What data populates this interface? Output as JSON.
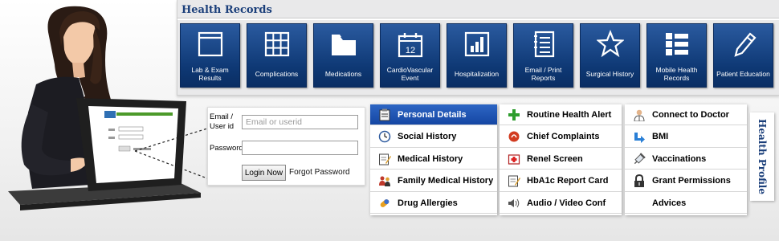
{
  "records": {
    "title": "Health Records",
    "tiles": [
      {
        "label": "Lab & Exam Results",
        "icon": "window-icon"
      },
      {
        "label": "Complications",
        "icon": "grid-icon"
      },
      {
        "label": "Medications",
        "icon": "folder-icon"
      },
      {
        "label": "CardioVascular Event",
        "icon": "calendar-icon",
        "icon_text": "12"
      },
      {
        "label": "Hospitalization",
        "icon": "bar-chart-icon"
      },
      {
        "label": "Email / Print Reports",
        "icon": "notebook-icon"
      },
      {
        "label": "Surgical History",
        "icon": "star-icon"
      },
      {
        "label": "Mobile Health Records",
        "icon": "list-icon"
      },
      {
        "label": "Patient Education",
        "icon": "pencil-icon"
      }
    ]
  },
  "login": {
    "email_label": "Email / User id",
    "email_placeholder": "Email or userid",
    "password_label": "Password",
    "login_button": "Login Now",
    "forgot_link": "Forgot Password"
  },
  "profile": {
    "tab_label": "Health Profile",
    "columns": [
      [
        {
          "label": "Personal Details",
          "icon": "clipboard-icon",
          "active": true
        },
        {
          "label": "Social History",
          "icon": "clock-icon"
        },
        {
          "label": "Medical History",
          "icon": "edit-note-icon"
        },
        {
          "label": "Family Medical History",
          "icon": "family-icon"
        },
        {
          "label": "Drug Allergies",
          "icon": "pill-icon"
        }
      ],
      [
        {
          "label": "Routine Health Alert",
          "icon": "plus-icon"
        },
        {
          "label": "Chief Complaints",
          "icon": "alert-circle-icon"
        },
        {
          "label": "Renel Screen",
          "icon": "first-aid-icon"
        },
        {
          "label": "HbA1c Report Card",
          "icon": "edit-note-icon"
        },
        {
          "label": "Audio / Video Conf",
          "icon": "speaker-icon"
        }
      ],
      [
        {
          "label": "Connect to Doctor",
          "icon": "doctor-icon"
        },
        {
          "label": "BMI",
          "icon": "arrow-icon"
        },
        {
          "label": "Vaccinations",
          "icon": "syringe-icon"
        },
        {
          "label": "Grant Permissions",
          "icon": "padlock-icon"
        },
        {
          "label": "Advices",
          "icon": ""
        }
      ]
    ]
  },
  "colors": {
    "tile_blue": "#0e3874",
    "active_blue": "#1f56b8",
    "title_navy": "#1b3f7a"
  }
}
